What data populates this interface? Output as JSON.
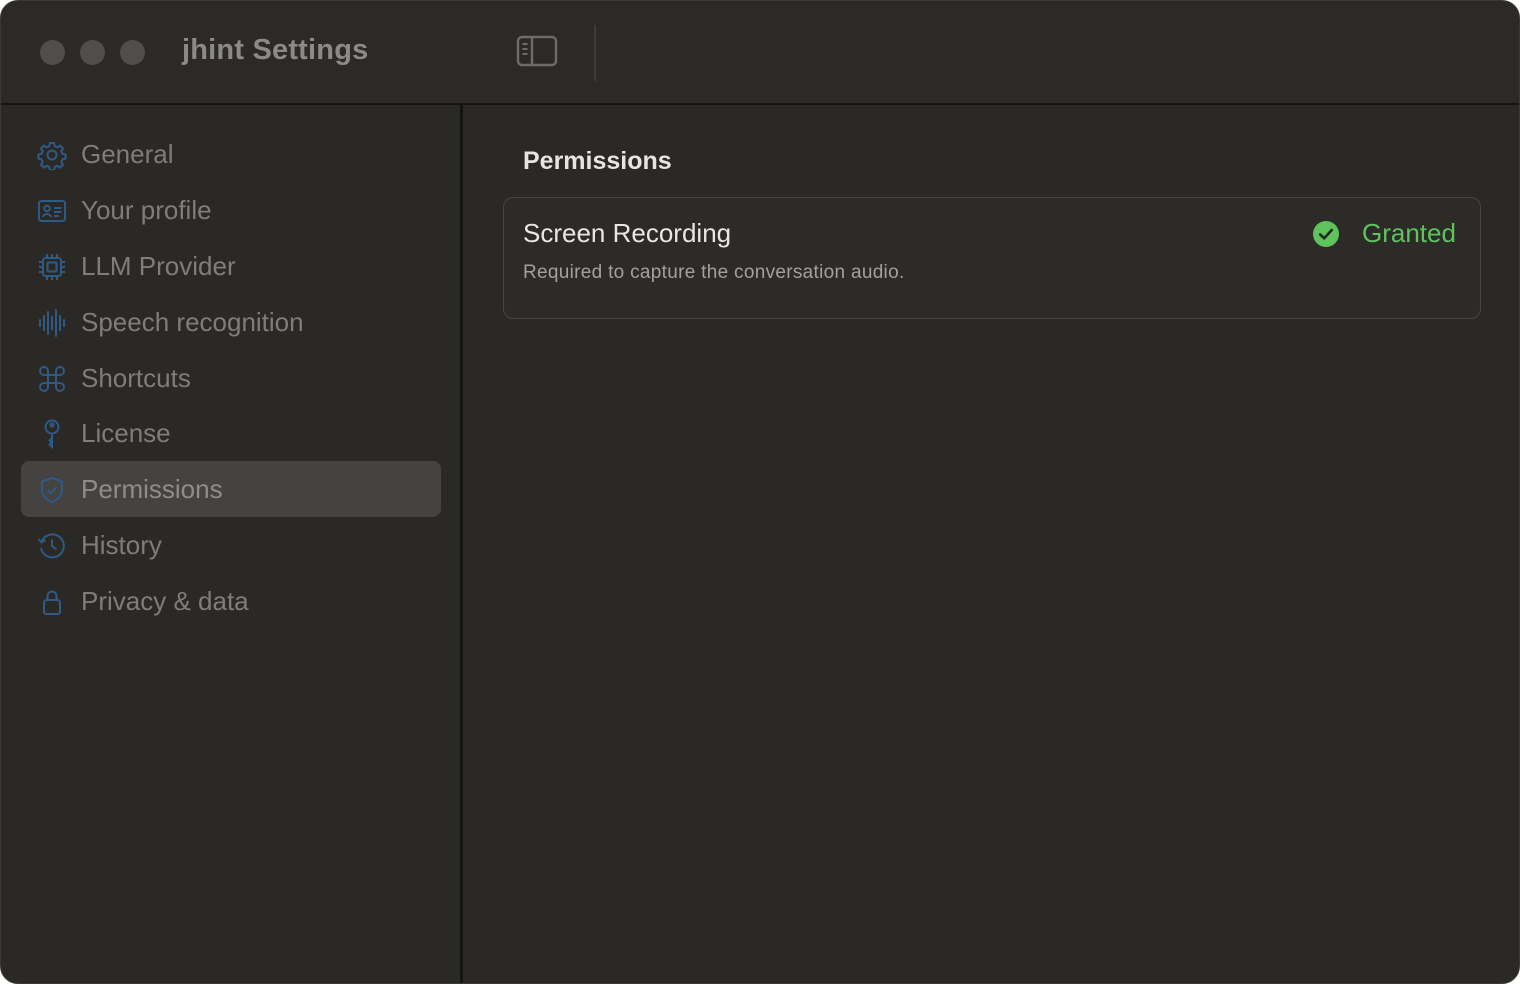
{
  "window": {
    "title": "jhint Settings"
  },
  "sidebar": {
    "items": [
      {
        "label": "General",
        "icon": "gear-icon"
      },
      {
        "label": "Your profile",
        "icon": "profile-card-icon"
      },
      {
        "label": "LLM Provider",
        "icon": "cpu-chip-icon"
      },
      {
        "label": "Speech recognition",
        "icon": "waveform-icon"
      },
      {
        "label": "Shortcuts",
        "icon": "command-key-icon"
      },
      {
        "label": "License",
        "icon": "key-icon"
      },
      {
        "label": "Permissions",
        "icon": "shield-check-icon",
        "selected": true
      },
      {
        "label": "History",
        "icon": "history-clock-icon"
      },
      {
        "label": "Privacy & data",
        "icon": "lock-icon"
      }
    ]
  },
  "main": {
    "section_title": "Permissions",
    "permissions": [
      {
        "name": "Screen Recording",
        "description": "Required to capture the conversation audio.",
        "status": "Granted",
        "status_icon": "checkmark-circle-icon"
      }
    ]
  },
  "colors": {
    "window_bg": "#2a2926",
    "selected_item_bg": "#444341",
    "icon_accent": "#2f5a86",
    "granted": "#5ec35c",
    "text_primary": "#e8e7e4",
    "text_secondary": "#a3a19d",
    "text_dimmed": "#7f7d79"
  }
}
